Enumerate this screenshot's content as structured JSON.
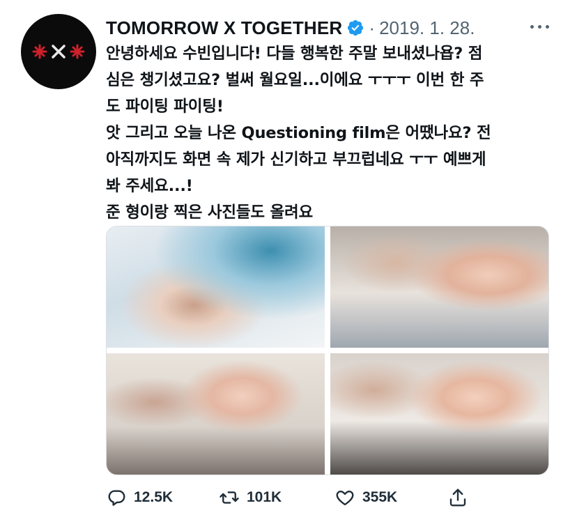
{
  "tweet": {
    "author": "TOMORROW X TOGETHER",
    "separator": "·",
    "date": "2019. 1. 28.",
    "text": "안녕하세요 수빈입니다! 다들 행복한 주말 보내셨나욥? 점\n심은 챙기셨고요? 벌써 월요일...이에요 ㅜㅜㅜ 이번 한 주\n도 파이팅 파이팅!\n앗 그리고 오늘 나온 Questioning film은 어땠나요? 전\n아직까지도 화면 속 제가 신기하고 부끄럽네요 ㅜㅜ 예쁘게\n봐 주세요...!\n준 형이랑 찍은 사진들도 올려요"
  },
  "icons": {
    "avatar": "txt-logo",
    "verified": "verified-badge-icon",
    "more": "more-dots-icon",
    "reply": "reply-icon",
    "retweet": "retweet-icon",
    "like": "heart-icon",
    "share": "share-icon"
  },
  "colors": {
    "accent": "#1d9bf0",
    "secondary_text": "#536471",
    "logo_red": "#d0202a"
  },
  "media": [
    "photo-1",
    "photo-2",
    "photo-3",
    "photo-4"
  ],
  "actions": {
    "replies": "12.5K",
    "retweets": "101K",
    "likes": "355K"
  }
}
